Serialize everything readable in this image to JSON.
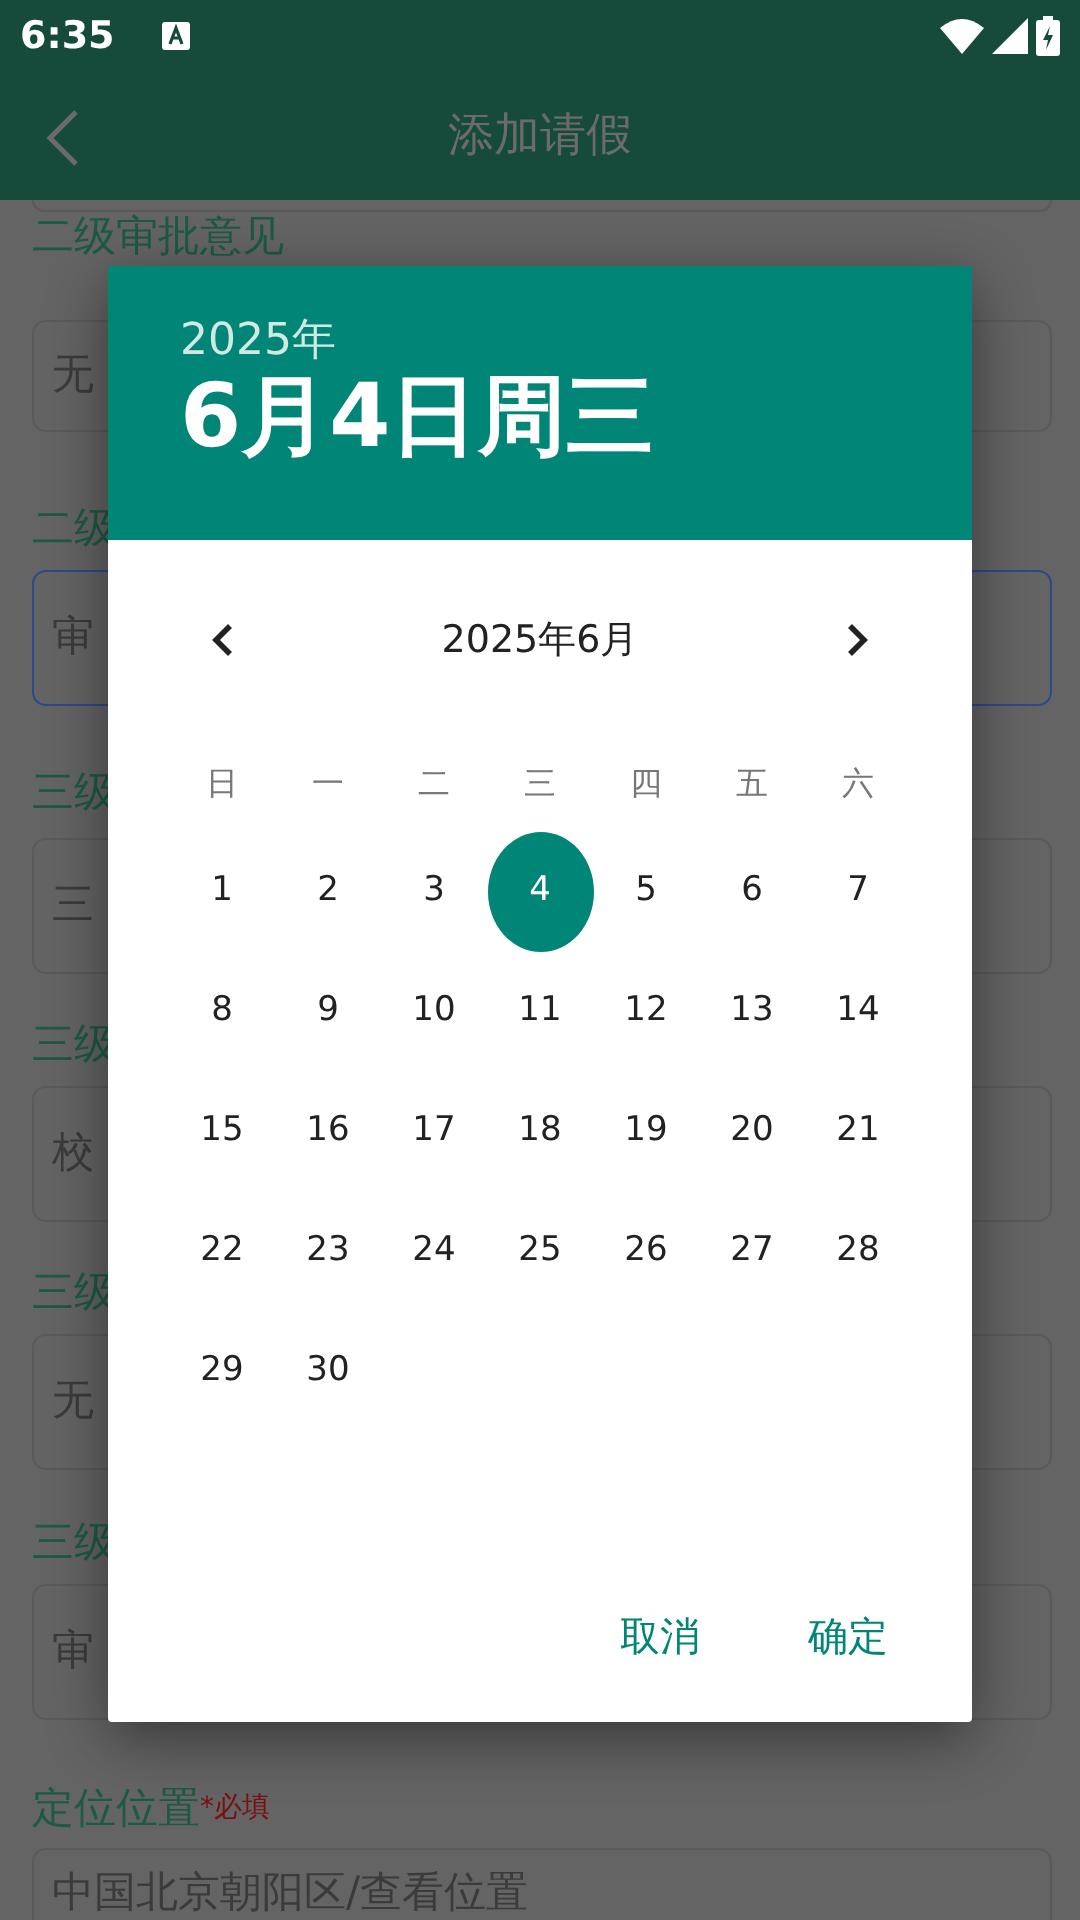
{
  "status_bar": {
    "time": "6:35"
  },
  "app_bar": {
    "title": "添加请假"
  },
  "form": [
    {
      "label": "二级审批意见",
      "value": "无",
      "focused": false
    },
    {
      "label": "二级",
      "value": "审",
      "focused": true
    },
    {
      "label": "三级",
      "value": "三",
      "focused": false
    },
    {
      "label": "三级",
      "value": "校",
      "focused": false
    },
    {
      "label": "三级",
      "value": "无",
      "focused": false
    },
    {
      "label": "三级",
      "value": "审",
      "focused": false
    },
    {
      "label": "定位位置",
      "required": "*必填",
      "value": "中国北京朝阳区/查看位置",
      "focused": false
    }
  ],
  "date_picker": {
    "year": "2025年",
    "date": "6月4日周三",
    "month_title": "2025年6月",
    "weekdays": [
      "日",
      "一",
      "二",
      "三",
      "四",
      "五",
      "六"
    ],
    "days": [
      {
        "label": "1",
        "selected": false
      },
      {
        "label": "2",
        "selected": false
      },
      {
        "label": "3",
        "selected": false
      },
      {
        "label": "4",
        "selected": true
      },
      {
        "label": "5",
        "selected": false
      },
      {
        "label": "6",
        "selected": false
      },
      {
        "label": "7",
        "selected": false
      },
      {
        "label": "8",
        "selected": false
      },
      {
        "label": "9",
        "selected": false
      },
      {
        "label": "10",
        "selected": false
      },
      {
        "label": "11",
        "selected": false
      },
      {
        "label": "12",
        "selected": false
      },
      {
        "label": "13",
        "selected": false
      },
      {
        "label": "14",
        "selected": false
      },
      {
        "label": "15",
        "selected": false
      },
      {
        "label": "16",
        "selected": false
      },
      {
        "label": "17",
        "selected": false
      },
      {
        "label": "18",
        "selected": false
      },
      {
        "label": "19",
        "selected": false
      },
      {
        "label": "20",
        "selected": false
      },
      {
        "label": "21",
        "selected": false
      },
      {
        "label": "22",
        "selected": false
      },
      {
        "label": "23",
        "selected": false
      },
      {
        "label": "24",
        "selected": false
      },
      {
        "label": "25",
        "selected": false
      },
      {
        "label": "26",
        "selected": false
      },
      {
        "label": "27",
        "selected": false
      },
      {
        "label": "28",
        "selected": false
      },
      {
        "label": "29",
        "selected": false
      },
      {
        "label": "30",
        "selected": false
      }
    ],
    "buttons": [
      "取消",
      "确定"
    ]
  }
}
